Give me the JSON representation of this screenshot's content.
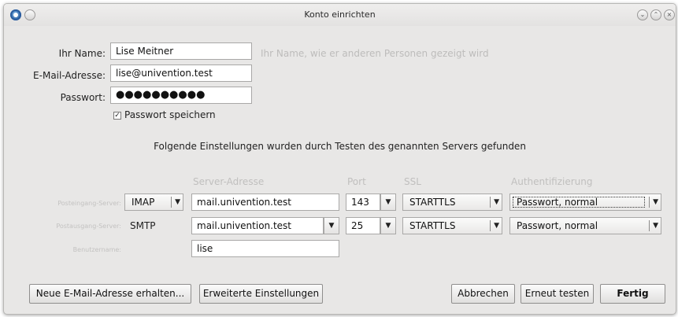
{
  "window": {
    "title": "Konto einrichten"
  },
  "form": {
    "name_label": "Ihr Name:",
    "name_value": "Lise Meitner",
    "name_hint": "Ihr Name, wie er anderen Personen gezeigt wird",
    "email_label": "E-Mail-Adresse:",
    "email_value": "lise@univention.test",
    "password_label": "Passwort:",
    "password_value": "●●●●●●●●●●",
    "remember_checked": true,
    "remember_label": "Passwort speichern"
  },
  "notice": "Folgende Einstellungen wurden durch Testen des genannten Servers gefunden",
  "server_table": {
    "headers": {
      "server_address": "Server-Adresse",
      "port": "Port",
      "ssl": "SSL",
      "auth": "Authentifizierung"
    },
    "incoming": {
      "label": "Posteingang-Server:",
      "protocol": "IMAP",
      "host": "mail.univention.test",
      "port": "143",
      "ssl": "STARTTLS",
      "auth": "Passwort, normal"
    },
    "outgoing": {
      "label": "Postausgang-Server:",
      "protocol": "SMTP",
      "host": "mail.univention.test",
      "port": "25",
      "ssl": "STARTTLS",
      "auth": "Passwort, normal"
    },
    "username": {
      "label": "Benutzername:",
      "value": "lise"
    }
  },
  "buttons": {
    "new_address": "Neue E-Mail-Adresse erhalten...",
    "advanced": "Erweiterte Einstellungen",
    "cancel": "Abbrechen",
    "retest": "Erneut testen",
    "done": "Fertig"
  },
  "icons": {
    "app": "thunderbird-app-icon",
    "menu": "window-menu-icon",
    "minimize": "minimize-icon",
    "maximize": "maximize-icon",
    "close": "close-icon",
    "dropdown": "triangle-down-icon",
    "check": "checkmark-icon"
  }
}
